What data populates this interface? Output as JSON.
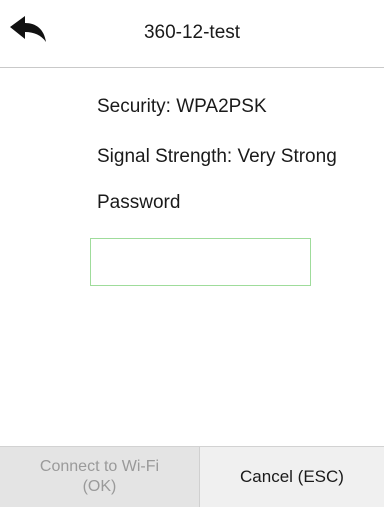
{
  "header": {
    "back_icon": "back-arrow-icon",
    "title": "360-12-test"
  },
  "details": {
    "security_label": "Security:",
    "security_value": "WPA2PSK",
    "signal_label": "Signal Strength:",
    "signal_value": "Very Strong",
    "password_label": "Password"
  },
  "password_input": {
    "value": ""
  },
  "footer": {
    "connect_line1": "Connect to Wi-Fi",
    "connect_line2": "(OK)",
    "cancel_label": "Cancel (ESC)"
  },
  "colors": {
    "input_border": "#9fdc9b",
    "connect_bg": "#e4e4e4",
    "cancel_bg": "#f0f0f0"
  }
}
